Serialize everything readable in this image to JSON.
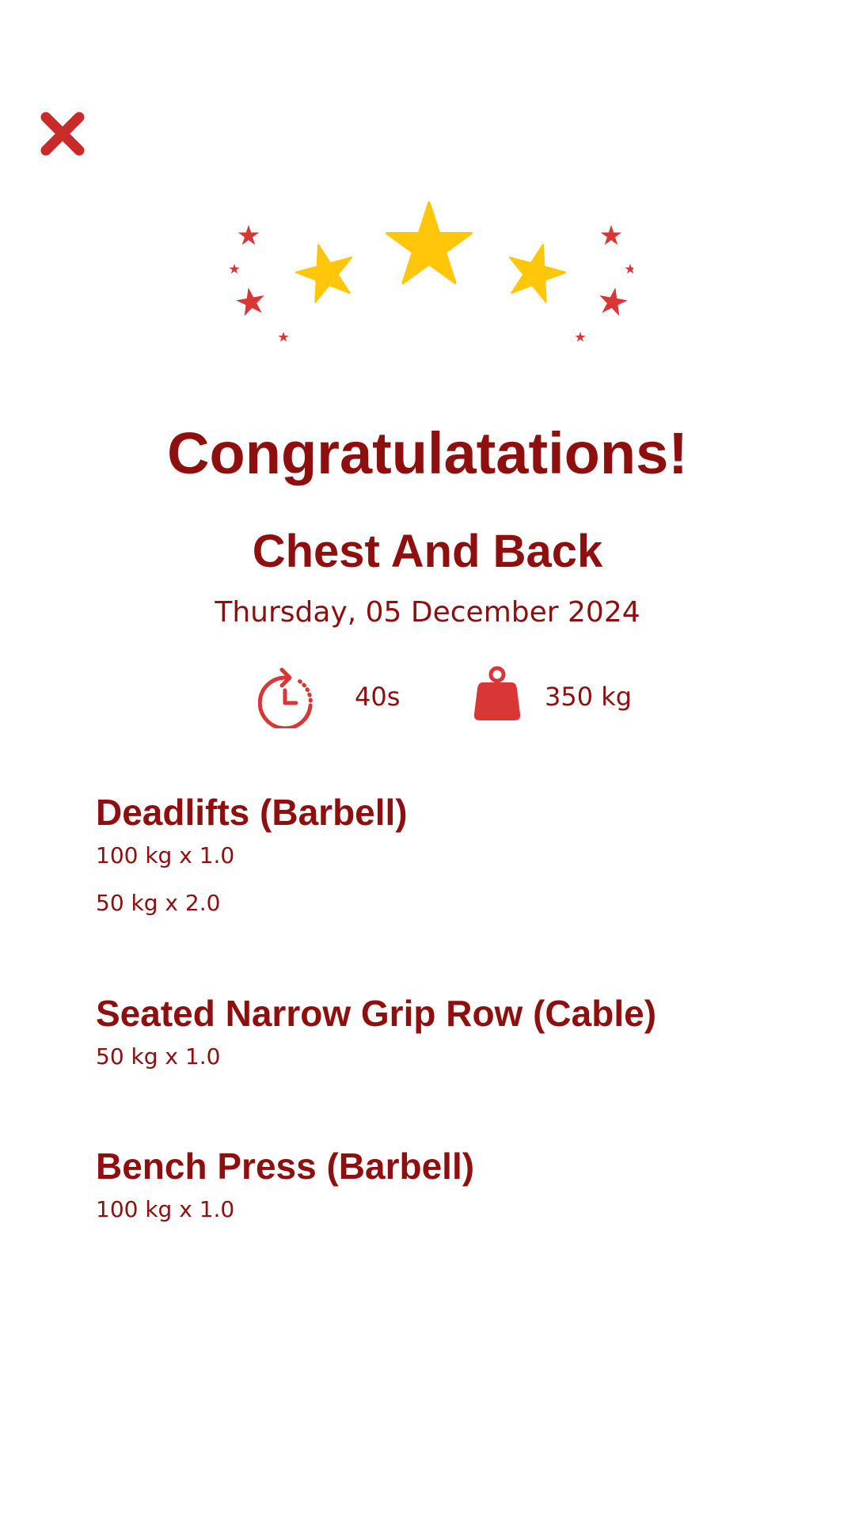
{
  "header": {
    "close_icon": "close-icon"
  },
  "colors": {
    "primary": "#8f0f0f",
    "accent_red": "#d93636",
    "star_gold": "#ffc60a"
  },
  "celebration": {
    "icon": "stars-icon",
    "title": "Congratulatations!"
  },
  "workout": {
    "name": "Chest And Back",
    "date": "Thursday, 05 December 2024",
    "duration": "40s",
    "volume": "350 kg"
  },
  "exercises": [
    {
      "name": "Deadlifts (Barbell)",
      "sets": [
        "100 kg x 1.0",
        "50 kg x 2.0"
      ]
    },
    {
      "name": "Seated Narrow Grip Row (Cable)",
      "sets": [
        "50 kg x 1.0"
      ]
    },
    {
      "name": "Bench Press (Barbell)",
      "sets": [
        "100 kg x 1.0"
      ]
    }
  ]
}
